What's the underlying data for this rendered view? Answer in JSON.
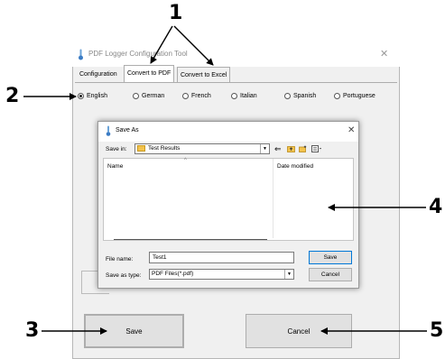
{
  "app": {
    "title": "PDF Logger Configuration Tool",
    "close_glyph": "✕",
    "tabs": [
      {
        "label": "Configuration",
        "selected": false
      },
      {
        "label": "Convert to PDF",
        "selected": true
      },
      {
        "label": "Convert to Excel",
        "selected": false
      }
    ],
    "languages": [
      {
        "label": "English",
        "selected": true
      },
      {
        "label": "German",
        "selected": false
      },
      {
        "label": "French",
        "selected": false
      },
      {
        "label": "Italian",
        "selected": false
      },
      {
        "label": "Spanish",
        "selected": false
      },
      {
        "label": "Portuguese",
        "selected": false
      }
    ],
    "save_button": "Save",
    "cancel_button": "Cancel"
  },
  "save_dialog": {
    "title": "Save As",
    "close_glyph": "✕",
    "save_in_label": "Save in:",
    "save_in_value": "Test Results",
    "columns": {
      "name": "Name",
      "date": "Date modified"
    },
    "file_name_label": "File name:",
    "file_name_value": "Test1",
    "save_as_type_label": "Save as type:",
    "save_as_type_value": "PDF Files(*.pdf)",
    "save_button": "Save",
    "cancel_button": "Cancel"
  },
  "callouts": {
    "c1": "1",
    "c2": "2",
    "c3": "3",
    "c4": "4",
    "c5": "5"
  },
  "icons": {
    "app": "thermometer-icon",
    "folder": "folder-icon",
    "back": "back-arrow-icon",
    "up": "up-folder-icon",
    "new_folder": "new-folder-icon",
    "views": "view-menu-icon"
  },
  "colors": {
    "window_bg": "#f0f0f0",
    "accent": "#0078d7",
    "folder": "#f3c34d"
  }
}
